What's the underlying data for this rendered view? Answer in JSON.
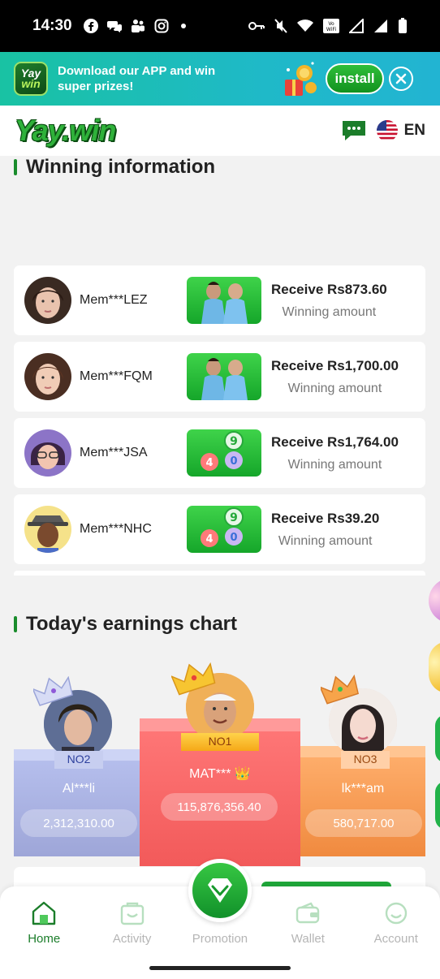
{
  "status_bar": {
    "time": "14:30"
  },
  "download_banner": {
    "logo_top": "Yay",
    "logo_bottom": "win",
    "text": "Download our APP and win super prizes!",
    "install_label": "install"
  },
  "header": {
    "brand": "Yay.win",
    "language": "EN"
  },
  "winning": {
    "title": "Winning information",
    "rows": [
      {
        "member": "Mem***LEZ",
        "amount": "Receive Rs873.60",
        "label": "Winning amount",
        "game": "football"
      },
      {
        "member": "Mem***FQM",
        "amount": "Receive Rs1,700.00",
        "label": "Winning amount",
        "game": "football"
      },
      {
        "member": "Mem***JSA",
        "amount": "Receive Rs1,764.00",
        "label": "Winning amount",
        "game": "lottery"
      },
      {
        "member": "Mem***NHC",
        "amount": "Receive Rs39.20",
        "label": "Winning amount",
        "game": "lottery"
      }
    ]
  },
  "earnings": {
    "title": "Today's earnings chart",
    "podium": [
      {
        "rank": "NO1",
        "name": "MAT*** 👑",
        "value": "115,876,356.40"
      },
      {
        "rank": "NO2",
        "name": "Al***li",
        "value": "2,312,310.00"
      },
      {
        "rank": "NO3",
        "name": "lk***am",
        "value": "580,717.00"
      }
    ]
  },
  "nav": {
    "items": [
      {
        "label": "Home",
        "icon": "home-icon",
        "active": true
      },
      {
        "label": "Activity",
        "icon": "activity-icon",
        "active": false
      },
      {
        "label": "Promotion",
        "icon": "promotion-icon",
        "active": false
      },
      {
        "label": "Wallet",
        "icon": "wallet-icon",
        "active": false
      },
      {
        "label": "Account",
        "icon": "account-icon",
        "active": false
      }
    ]
  },
  "colors": {
    "brand_green": "#1b7d2a",
    "banner": "#1fb9c8",
    "no1": "#f55a5a",
    "no2": "#a9b3e3",
    "no3": "#f79a56"
  }
}
